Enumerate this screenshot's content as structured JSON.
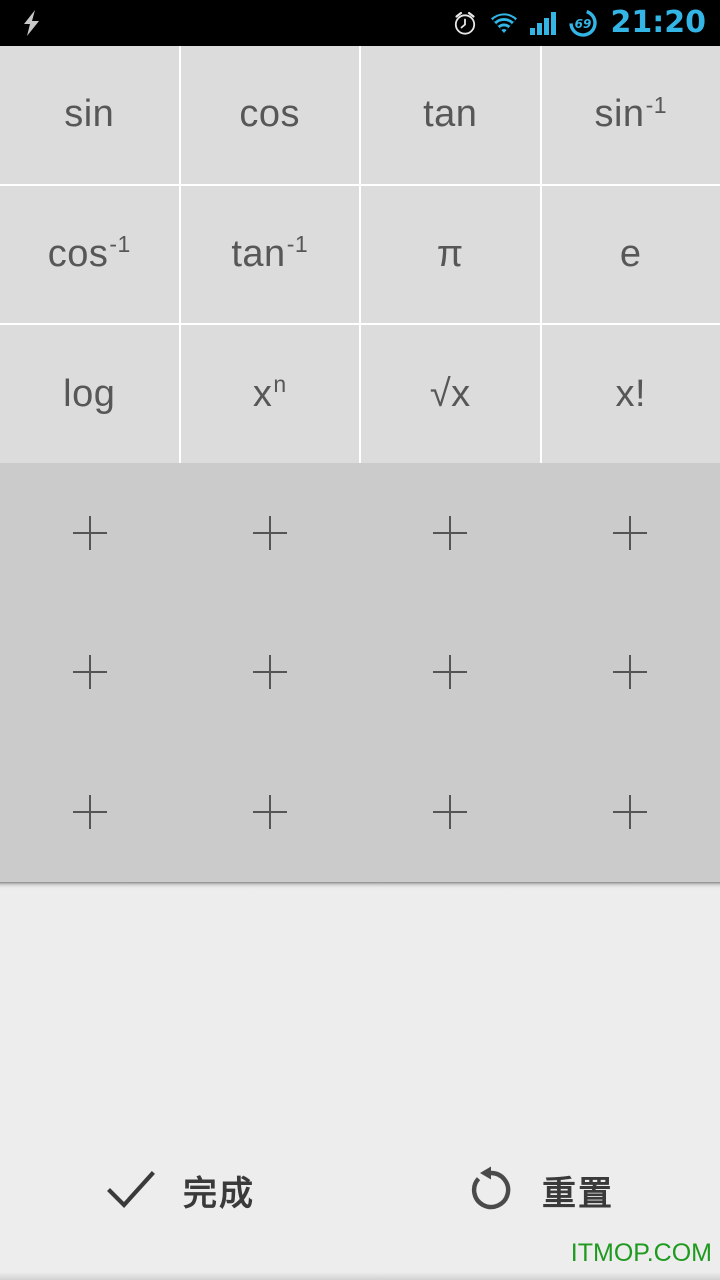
{
  "status_bar": {
    "charging_icon": "lightning-bolt-icon",
    "alarm_icon": "alarm-clock-icon",
    "wifi_icon": "wifi-icon",
    "signal_icon": "cellular-signal-icon",
    "battery_icon": "battery-circle-icon",
    "battery_level": "69",
    "time": "21:20",
    "accent_color": "#33b5e5"
  },
  "key_grid": {
    "keys": [
      {
        "label": "sin",
        "base": "sin",
        "sup": ""
      },
      {
        "label": "cos",
        "base": "cos",
        "sup": ""
      },
      {
        "label": "tan",
        "base": "tan",
        "sup": ""
      },
      {
        "label": "sin-1",
        "base": "sin",
        "sup": "-1"
      },
      {
        "label": "cos-1",
        "base": "cos",
        "sup": "-1"
      },
      {
        "label": "tan-1",
        "base": "tan",
        "sup": "-1"
      },
      {
        "label": "pi",
        "base": "π",
        "sup": ""
      },
      {
        "label": "e",
        "base": "e",
        "sup": ""
      },
      {
        "label": "log",
        "base": "log",
        "sup": ""
      },
      {
        "label": "x^n",
        "base": "x",
        "sup": "n"
      },
      {
        "label": "sqrt",
        "base": "√x",
        "sup": ""
      },
      {
        "label": "fact",
        "base": "x!",
        "sup": ""
      }
    ],
    "key_background": "#dcdcdc",
    "key_text_color": "#575757"
  },
  "slot_area": {
    "add_glyph": "+",
    "background": "#cbcbcb",
    "slots": [
      {
        "name": "empty-slot-1"
      },
      {
        "name": "empty-slot-2"
      },
      {
        "name": "empty-slot-3"
      },
      {
        "name": "empty-slot-4"
      },
      {
        "name": "empty-slot-5"
      },
      {
        "name": "empty-slot-6"
      },
      {
        "name": "empty-slot-7"
      },
      {
        "name": "empty-slot-8"
      },
      {
        "name": "empty-slot-9"
      },
      {
        "name": "empty-slot-10"
      },
      {
        "name": "empty-slot-11"
      },
      {
        "name": "empty-slot-12"
      }
    ]
  },
  "action_bar": {
    "done_label": "完成",
    "done_icon": "checkmark-icon",
    "reset_label": "重置",
    "reset_icon": "rotate-ccw-icon"
  },
  "watermark": {
    "text": "ITMOP.COM",
    "color": "#1f9a1f"
  }
}
